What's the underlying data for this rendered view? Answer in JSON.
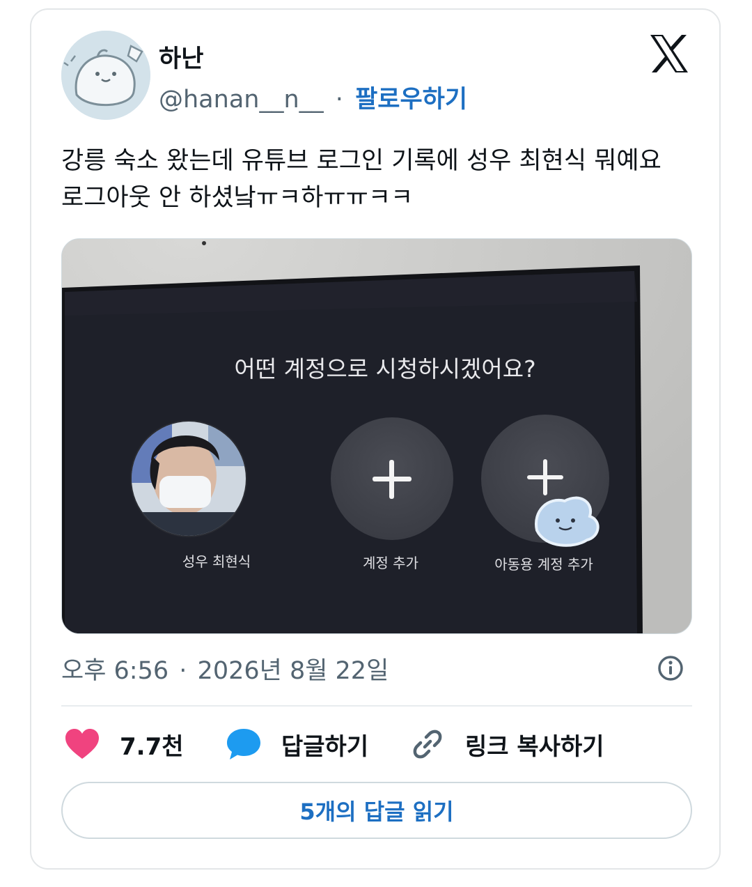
{
  "author": {
    "display_name": "하난",
    "handle": "@hanan__n__",
    "separator": "·",
    "follow_label": "팔로우하기"
  },
  "tweet": {
    "text_line1": "강릉 숙소 왔는데 유튜브 로그인 기록에 성우 최현식 뭐예요",
    "text_line2": "로그아웃 안 하셨낰ㅠㅋ하ㅠㅠㅋㅋ"
  },
  "media": {
    "prompt": "어떤 계정으로 시청하시겠어요?",
    "profiles": [
      {
        "label": "성우 최현식"
      },
      {
        "label": "계정 추가"
      },
      {
        "label": "아동용 계정 추가"
      }
    ]
  },
  "meta": {
    "time": "오후 6:56",
    "separator": "·",
    "date": "2026년 8월 22일"
  },
  "actions": {
    "like_count": "7.7천",
    "reply_label": "답글하기",
    "copy_link_label": "링크 복사하기"
  },
  "read_replies_label": "5개의 답글 읽기",
  "colors": {
    "accent": "#1d6fc2",
    "like": "#f0437f",
    "reply_bubble": "#1d9bf0",
    "tv_screen": "#1e2029"
  },
  "icons": {
    "brand": "x-logo-icon",
    "info": "info-icon",
    "like": "heart-icon",
    "reply": "speech-bubble-icon",
    "copy": "link-icon",
    "add": "plus-icon"
  }
}
